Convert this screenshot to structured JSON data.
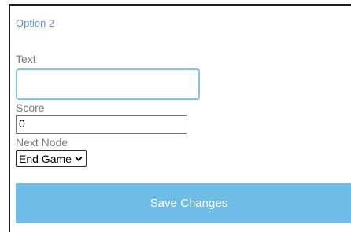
{
  "option": {
    "title": "Option 2"
  },
  "fields": {
    "text_label": "Text",
    "text_value": "",
    "score_label": "Score",
    "score_value": "0",
    "next_node_label": "Next Node",
    "next_node_selected": "End Game"
  },
  "actions": {
    "save_label": "Save Changes"
  },
  "colors": {
    "accent": "#6fbde6",
    "title": "#5b8fd6",
    "focus_border": "#7fc4e8"
  }
}
